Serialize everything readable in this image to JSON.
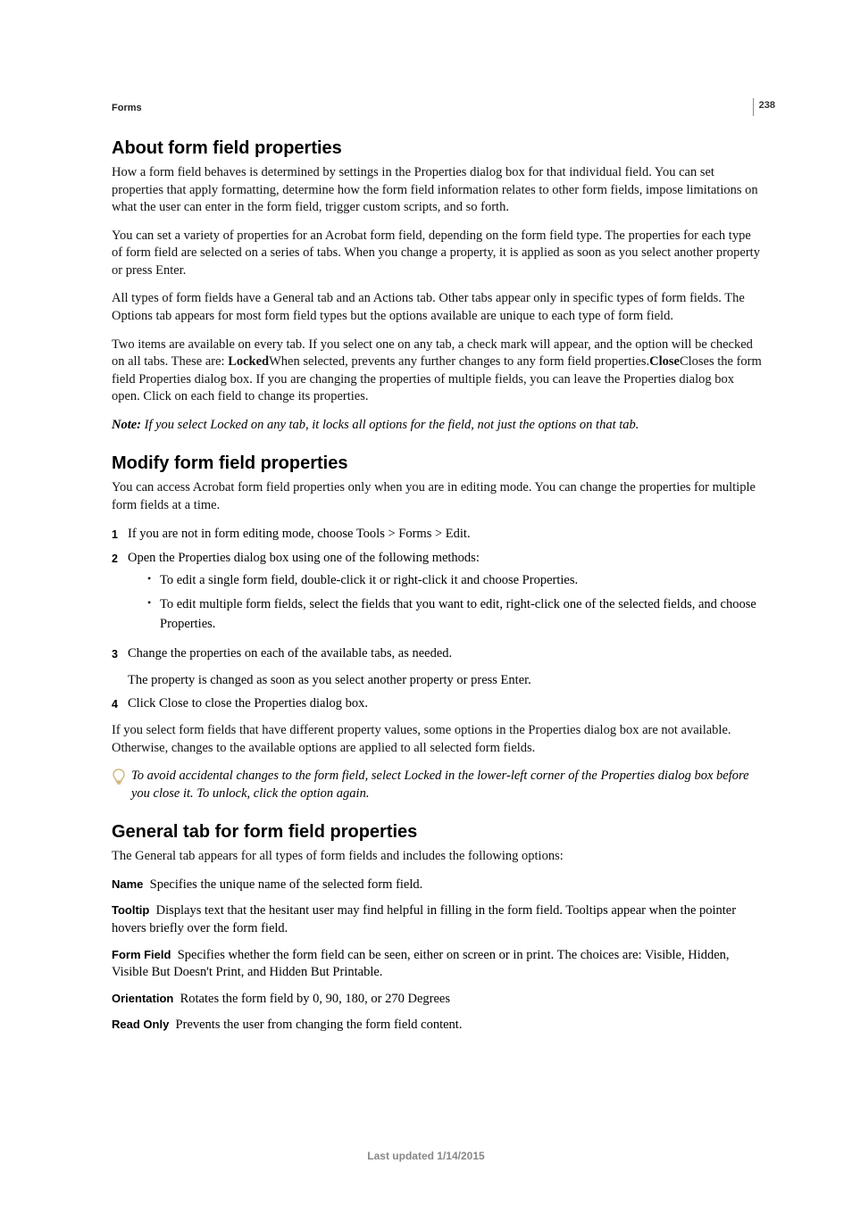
{
  "page_number": "238",
  "section_label": "Forms",
  "sections": {
    "about": {
      "heading": "About form field properties",
      "p1": "How a form field behaves is determined by settings in the Properties dialog box for that individual field. You can set properties that apply formatting, determine how the form field information relates to other form fields, impose limitations on what the user can enter in the form field, trigger custom scripts, and so forth.",
      "p2": "You can set a variety of properties for an Acrobat form field, depending on the form field type. The properties for each type of form field are selected on a series of tabs. When you change a property, it is applied as soon as you select another property or press Enter.",
      "p3": "All types of form fields have a General tab and an Actions tab. Other tabs appear only in specific types of form fields. The Options tab appears for most form field types but the options available are unique to each type of form field.",
      "p4_pre": "Two items are available on every tab. If you select one on any tab, a check mark will appear, and the option will be checked on all tabs. These are: ",
      "p4_bold1": "Locked",
      "p4_mid": "When selected, prevents any further changes to any form field properties.",
      "p4_bold2": "Close",
      "p4_end": "Closes the form field Properties dialog box. If you are changing the properties of multiple fields, you can leave the Properties dialog box open. Click on each field to change its properties.",
      "note_label": "Note: ",
      "note_text": "If you select Locked on any tab, it locks all options for the field, not just the options on that tab."
    },
    "modify": {
      "heading": "Modify form field properties",
      "intro": "You can access Acrobat form field properties only when you are in editing mode. You can change the properties for multiple form fields at a time.",
      "steps": [
        {
          "n": "1",
          "t": "If you are not in form editing mode, choose Tools > Forms > Edit."
        },
        {
          "n": "2",
          "t": "Open the Properties dialog box using one of the following methods:",
          "sub": [
            "To edit a single form field, double-click it or right-click it and choose Properties.",
            "To edit multiple form fields, select the fields that you want to edit, right-click one of the selected fields, and choose Properties."
          ]
        },
        {
          "n": "3",
          "t": "Change the properties on each of the available tabs, as needed.",
          "after": "The property is changed as soon as you select another property or press Enter."
        },
        {
          "n": "4",
          "t": "Click Close to close the Properties dialog box."
        }
      ],
      "after_p": "If you select form fields that have different property values, some options in the Properties dialog box are not available. Otherwise, changes to the available options are applied to all selected form fields.",
      "tip": "To avoid accidental changes to the form field, select Locked in the lower-left corner of the Properties dialog box before you close it. To unlock, click the option again."
    },
    "general": {
      "heading": "General tab for form field properties",
      "intro": "The General tab appears for all types of form fields and includes the following options:",
      "defs": [
        {
          "term": "Name",
          "desc": "Specifies the unique name of the selected form field."
        },
        {
          "term": "Tooltip",
          "desc": "Displays text that the hesitant user may find helpful in filling in the form field. Tooltips appear when the pointer hovers briefly over the form field."
        },
        {
          "term": "Form Field",
          "desc": "Specifies whether the form field can be seen, either on screen or in print. The choices are: Visible, Hidden, Visible But Doesn't Print, and Hidden But Printable."
        },
        {
          "term": "Orientation",
          "desc": "Rotates the form field by 0, 90, 180, or 270 Degrees"
        },
        {
          "term": "Read Only",
          "desc": "Prevents the user from changing the form field content."
        }
      ]
    }
  },
  "footer": "Last updated 1/14/2015"
}
